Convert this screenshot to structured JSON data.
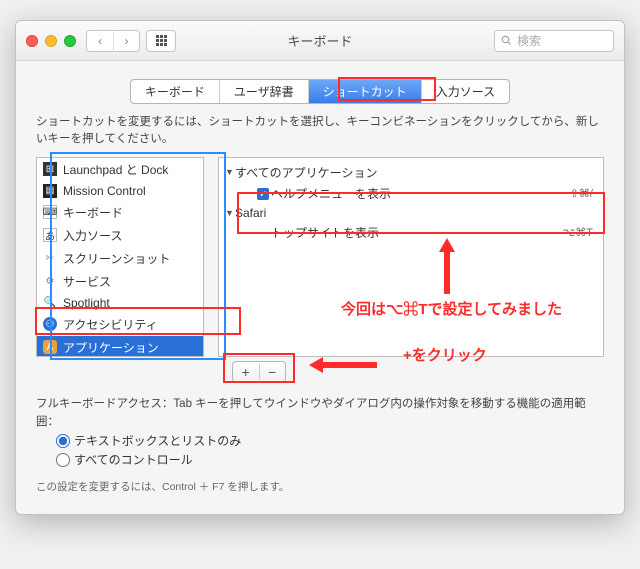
{
  "window": {
    "title": "キーボード",
    "search_placeholder": "検索"
  },
  "tabs": {
    "items": [
      "キーボード",
      "ユーザ辞書",
      "ショートカット",
      "入力ソース"
    ],
    "active_index": 2
  },
  "description": "ショートカットを変更するには、ショートカットを選択し、キーコンビネーションをクリックしてから、新しいキーを押してください。",
  "sidebar": {
    "items": [
      {
        "label": "Launchpad と Dock",
        "icon": "launchpad-icon"
      },
      {
        "label": "Mission Control",
        "icon": "mission-control-icon"
      },
      {
        "label": "キーボード",
        "icon": "keyboard-icon"
      },
      {
        "label": "入力ソース",
        "icon": "input-source-icon"
      },
      {
        "label": "スクリーンショット",
        "icon": "screenshot-icon"
      },
      {
        "label": "サービス",
        "icon": "services-icon"
      },
      {
        "label": "Spotlight",
        "icon": "spotlight-icon"
      },
      {
        "label": "アクセシビリティ",
        "icon": "accessibility-icon"
      },
      {
        "label": "アプリケーション",
        "icon": "application-icon"
      }
    ],
    "selected_index": 8
  },
  "shortcuts": {
    "group1_label": "すべてのアプリケーション",
    "item1_label": "ヘルプメニューを表示",
    "item1_shortcut": "⇧⌘/",
    "group2_label": "Safari",
    "item2_label": "トップサイトを表示",
    "item2_shortcut": "⌥⌘T"
  },
  "buttons": {
    "add": "+",
    "remove": "−"
  },
  "footer": {
    "fullkb_label": "フルキーボードアクセス：Tab キーを押してウインドウやダイアログ内の操作対象を移動する機能の適用範囲：",
    "radio1": "テキストボックスとリストのみ",
    "radio2": "すべてのコントロール",
    "note": "この設定を変更するには、Control ＋ F7 を押します。"
  },
  "annotations": {
    "text1": "今回は⌥⌘Tで設定してみました",
    "text2": "+をクリック"
  }
}
